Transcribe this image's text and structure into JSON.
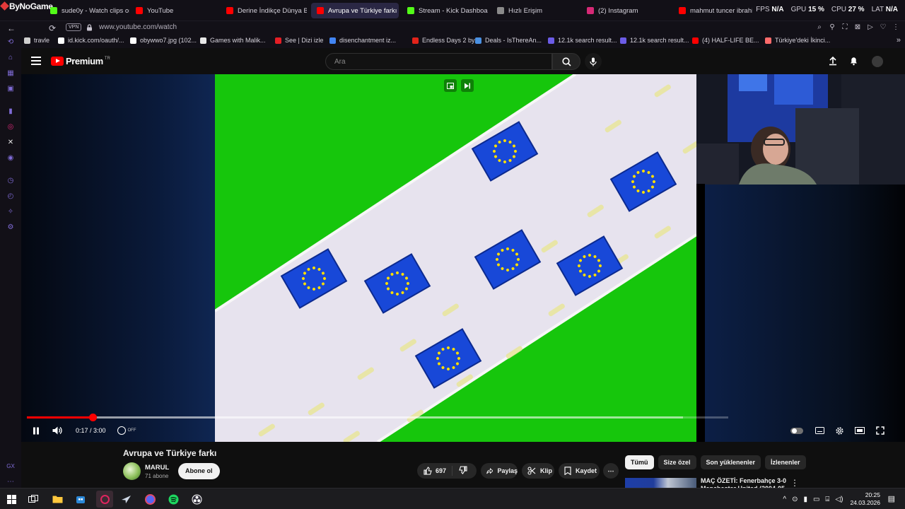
{
  "browser": {
    "brand": "ByNoGame",
    "tabs": [
      {
        "label": "sude0y - Watch clips on K",
        "color": "#53fc18",
        "active": false
      },
      {
        "label": "YouTube",
        "color": "#ff0000",
        "active": false
      },
      {
        "label": "Derine İndikçe Dünya Bir U",
        "color": "#ff0000",
        "active": false
      },
      {
        "label": "Avrupa ve Türkiye farkı",
        "color": "#ff0000",
        "active": true
      },
      {
        "label": "Stream - Kick Dashboard",
        "color": "#53fc18",
        "active": false
      },
      {
        "label": "Hızlı Erişim",
        "color": "#8a8a8a",
        "active": false
      },
      {
        "label": "(2) Instagram",
        "color": "#d62976",
        "active": false
      },
      {
        "label": "mahmut tuncer ibrahim tatl",
        "color": "#ff0000",
        "active": false
      }
    ],
    "stats": [
      {
        "label": "FPS",
        "value": "N/A"
      },
      {
        "label": "GPU",
        "value": "15 %"
      },
      {
        "label": "CPU",
        "value": "27 %"
      },
      {
        "label": "LAT",
        "value": "N/A"
      }
    ],
    "vpn_label": "VPN",
    "url": "www.youtube.com/watch"
  },
  "bookmarks": [
    {
      "label": "travle",
      "color": "#cfcfcf"
    },
    {
      "label": "id.kick.com/oauth/...",
      "color": "#ffffff"
    },
    {
      "label": "obywwo7.jpg (102...",
      "color": "#ffffff"
    },
    {
      "label": "Games with Malik...",
      "color": "#e8e8e8"
    },
    {
      "label": "See | Dizi izle",
      "color": "#e51e25"
    },
    {
      "label": "disenchantment iz...",
      "color": "#4285f4"
    },
    {
      "label": "Endless Days 2 by...",
      "color": "#e2231a"
    },
    {
      "label": "Deals - IsThereAn...",
      "color": "#4a90e2"
    },
    {
      "label": "12.1k search result...",
      "color": "#6c5ce7"
    },
    {
      "label": "12.1k search result...",
      "color": "#6c5ce7"
    },
    {
      "label": "(4) HALF-LIFE BE...",
      "color": "#ff0000"
    },
    {
      "label": "Türkiye'deki İkinci...",
      "color": "#ff6b6b"
    }
  ],
  "youtube": {
    "logo_text": "Premium",
    "region": "TR",
    "search_placeholder": "Ara",
    "player": {
      "elapsed": "0:17",
      "duration": "3:00",
      "time_display": "0:17 / 3:00",
      "progress": 0.094,
      "buffered": 0.935,
      "autoplay_label": "OFF"
    },
    "video": {
      "title": "Avrupa ve Türkiye farkı",
      "channel": "MARUL",
      "subscribers": "71 abone",
      "subscribe_label": "Abone ol",
      "likes": "697",
      "share_label": "Paylaş",
      "clip_label": "Klip",
      "save_label": "Kaydet"
    },
    "chips": [
      "Tümü",
      "Size özel",
      "Son yüklenenler",
      "İzlenenler"
    ],
    "recommendation": {
      "title": "MAÇ ÖZETİ: Fenerbahçe 3-0 Manchester United (2004-05"
    }
  },
  "taskbar": {
    "time": "20:25",
    "date": "24.03.2026"
  },
  "colors": {
    "accent": "#ff0000",
    "gx_purple": "#7f6bd6",
    "green_field": "#16c60c",
    "eu_blue": "#1848d8",
    "eu_star": "#ffde00"
  }
}
